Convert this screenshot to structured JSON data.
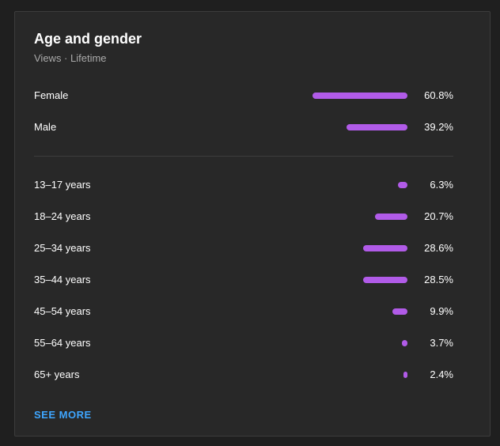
{
  "card": {
    "title": "Age and gender",
    "subtitle": "Views · Lifetime",
    "see_more_label": "SEE MORE"
  },
  "gender": [
    {
      "label": "Female",
      "value_text": "60.8%",
      "percent": 60.8
    },
    {
      "label": "Male",
      "value_text": "39.2%",
      "percent": 39.2
    }
  ],
  "age": [
    {
      "label": "13–17 years",
      "value_text": "6.3%",
      "percent": 6.3
    },
    {
      "label": "18–24 years",
      "value_text": "20.7%",
      "percent": 20.7
    },
    {
      "label": "25–34 years",
      "value_text": "28.6%",
      "percent": 28.6
    },
    {
      "label": "35–44 years",
      "value_text": "28.5%",
      "percent": 28.5
    },
    {
      "label": "45–54 years",
      "value_text": "9.9%",
      "percent": 9.9
    },
    {
      "label": "55–64 years",
      "value_text": "3.7%",
      "percent": 3.7
    },
    {
      "label": "65+ years",
      "value_text": "2.4%",
      "percent": 2.4
    }
  ],
  "colors": {
    "bar": "#b15be8",
    "link": "#3ea6ff",
    "card_background": "#282828"
  }
}
